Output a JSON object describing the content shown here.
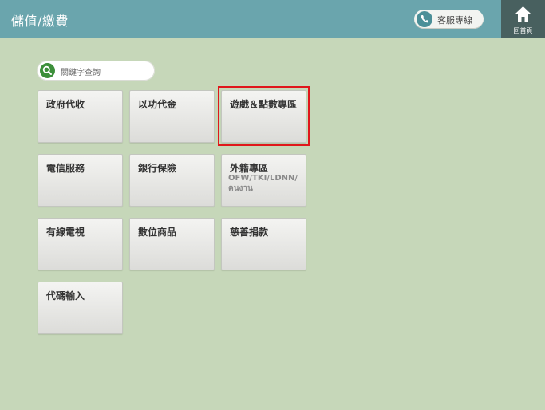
{
  "header": {
    "title": "儲值/繳費",
    "service_label": "客服專線",
    "home_label": "回首頁"
  },
  "search": {
    "placeholder": "關鍵字查詢"
  },
  "tiles": [
    {
      "label": "政府代收"
    },
    {
      "label": "以功代金"
    },
    {
      "label": "遊戲＆點數專區"
    },
    {
      "label": "電信服務"
    },
    {
      "label": "銀行保險"
    },
    {
      "label": "外籍專區",
      "sub": "OFW/TKI/LDNN/คนงาน"
    },
    {
      "label": "有線電視"
    },
    {
      "label": "數位商品"
    },
    {
      "label": "慈善捐款"
    },
    {
      "label": "代碼輸入"
    }
  ],
  "colors": {
    "header": "#6aa5ad",
    "background": "#c6d7b9",
    "home_button": "#48605f",
    "highlight": "#e0171b"
  }
}
